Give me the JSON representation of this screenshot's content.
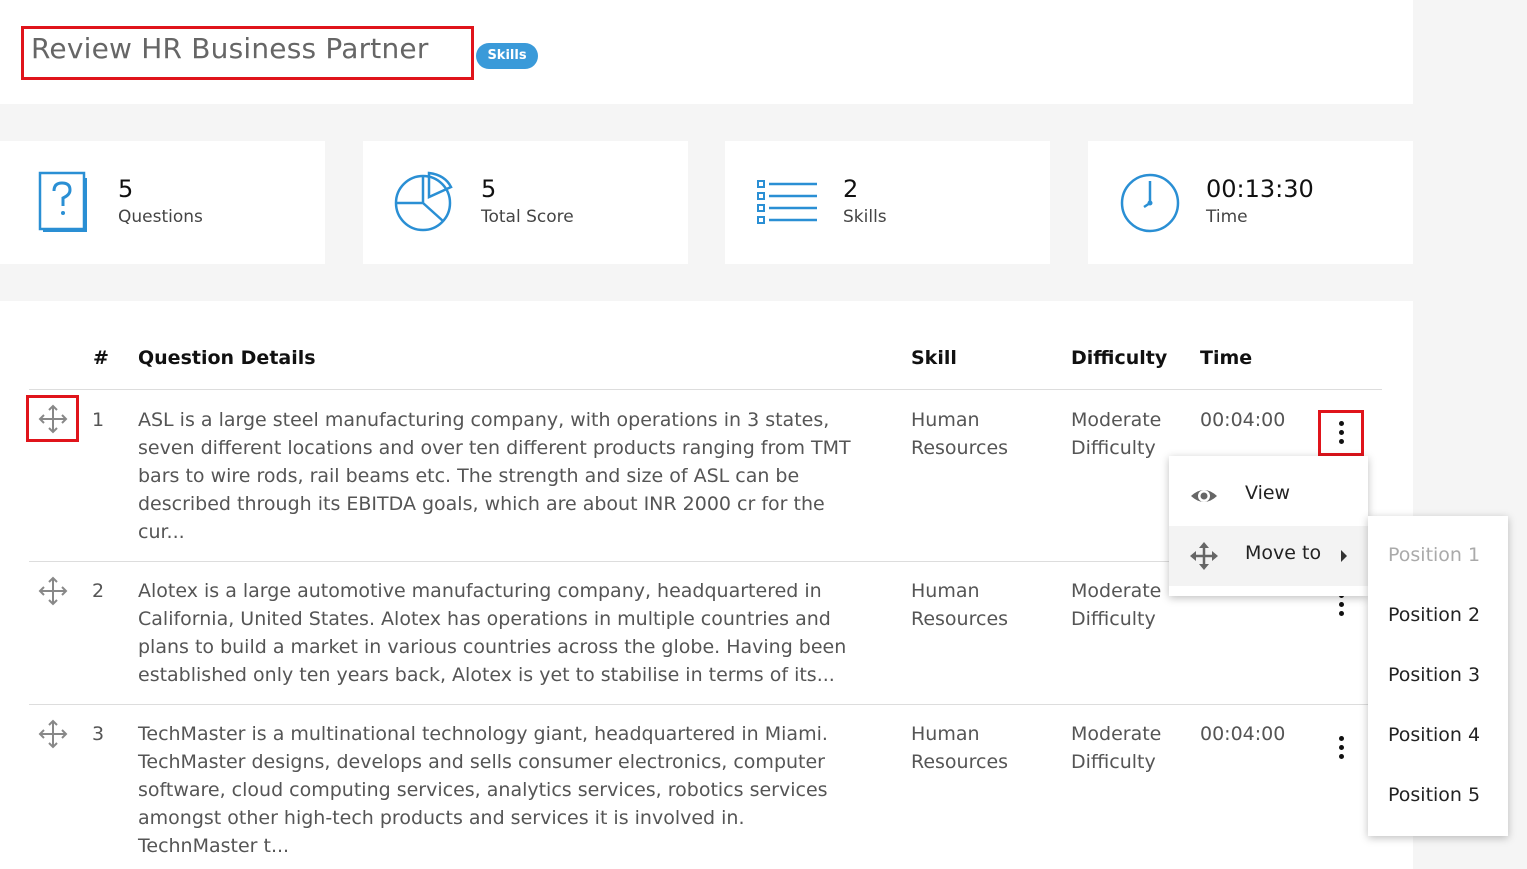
{
  "header": {
    "title": "Review HR Business Partner",
    "badge": "Skills"
  },
  "stats": [
    {
      "value": "5",
      "label": "Questions",
      "icon": "question-document-icon"
    },
    {
      "value": "5",
      "label": "Total Score",
      "icon": "pie-chart-icon"
    },
    {
      "value": "2",
      "label": "Skills",
      "icon": "list-icon"
    },
    {
      "value": "00:13:30",
      "label": "Time",
      "icon": "clock-icon"
    }
  ],
  "table": {
    "headers": {
      "num": "#",
      "details": "Question Details",
      "skill": "Skill",
      "difficulty": "Difficulty",
      "time": "Time"
    },
    "rows": [
      {
        "num": "1",
        "details": [
          "ASL is a large steel manufacturing company, with operations in 3 states,",
          "seven different locations and over ten different products ranging from TMT",
          "bars to wire rods, rail beams etc. The strength and size of ASL can be",
          "described through its EBITDA goals, which are about INR 2000 cr for the",
          "cur..."
        ],
        "skill": [
          "Human",
          "Resources"
        ],
        "difficulty": [
          "Moderate",
          "Difficulty"
        ],
        "time": "00:04:00"
      },
      {
        "num": "2",
        "details": [
          "Alotex is a large automotive manufacturing company, headquartered in",
          "California, United States. Alotex has operations in multiple countries and",
          "plans to build a market in various countries across the globe. Having been",
          "established only ten years back, Alotex is yet to stabilise in terms of its..."
        ],
        "skill": [
          "Human",
          "Resources"
        ],
        "difficulty": [
          "Moderate",
          "Difficulty"
        ],
        "time": ""
      },
      {
        "num": "3",
        "details": [
          "TechMaster is a multinational technology giant, headquartered in Miami.",
          "TechMaster designs, develops and sells consumer electronics, computer",
          "software, cloud computing services, analytics services, robotics services",
          "amongst other high-tech products and services it is involved in.",
          "TechnMaster t..."
        ],
        "skill": [
          "Human",
          "Resources"
        ],
        "difficulty": [
          "Moderate",
          "Difficulty"
        ],
        "time": "00:04:00"
      }
    ]
  },
  "menu": {
    "view": "View",
    "move_to": "Move to"
  },
  "submenu": [
    "Position 1",
    "Position 2",
    "Position 3",
    "Position 4",
    "Position 5"
  ],
  "colors": {
    "accent": "#3a9ad9",
    "highlight": "#e0141b"
  }
}
